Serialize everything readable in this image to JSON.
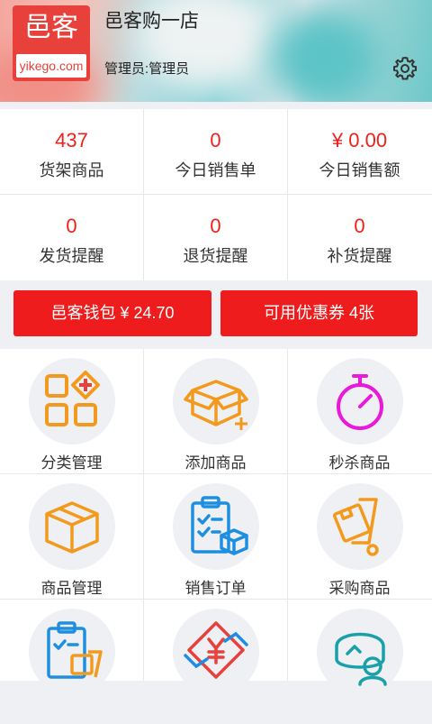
{
  "header": {
    "logo_cn": "邑客",
    "logo_domain": "yikego.com",
    "store_name": "邑客购一店",
    "manager_label": "管理员:管理员",
    "settings_icon": "gear-icon"
  },
  "stats": [
    {
      "value": "437",
      "label": "货架商品"
    },
    {
      "value": "0",
      "label": "今日销售单"
    },
    {
      "value": "¥ 0.00",
      "label": "今日销售额"
    },
    {
      "value": "0",
      "label": "发货提醒"
    },
    {
      "value": "0",
      "label": "退货提醒"
    },
    {
      "value": "0",
      "label": "补货提醒"
    }
  ],
  "buttons": {
    "wallet": "邑客钱包 ¥ 24.70",
    "coupons": "可用优惠券 4张"
  },
  "menu": [
    {
      "label": "分类管理",
      "icon": "category-grid-icon"
    },
    {
      "label": "添加商品",
      "icon": "add-box-icon"
    },
    {
      "label": "秒杀商品",
      "icon": "stopwatch-icon"
    },
    {
      "label": "商品管理",
      "icon": "box-icon"
    },
    {
      "label": "销售订单",
      "icon": "clipboard-order-icon"
    },
    {
      "label": "采购商品",
      "icon": "hand-truck-icon"
    },
    {
      "label": "",
      "icon": "clipboard-cart-icon"
    },
    {
      "label": "",
      "icon": "yuan-exchange-icon"
    },
    {
      "label": "",
      "icon": "customer-service-icon"
    }
  ],
  "colors": {
    "accent_red": "#ee1c1c",
    "orange": "#f39a1e",
    "magenta": "#e81ad8",
    "blue": "#1e8fe0"
  }
}
